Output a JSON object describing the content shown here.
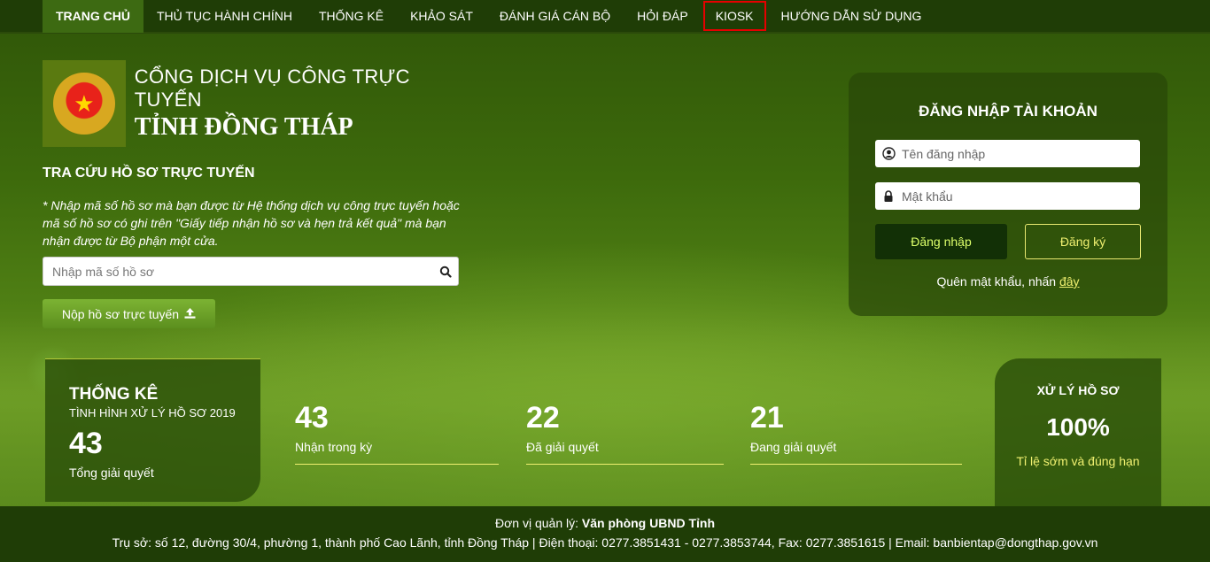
{
  "nav": {
    "items": [
      {
        "label": "TRANG CHỦ"
      },
      {
        "label": "THỦ TỤC HÀNH CHÍNH"
      },
      {
        "label": "THỐNG KÊ"
      },
      {
        "label": "KHẢO SÁT"
      },
      {
        "label": "ĐÁNH GIÁ CÁN BỘ"
      },
      {
        "label": "HỎI ĐÁP"
      },
      {
        "label": "KIOSK"
      },
      {
        "label": "HƯỚNG DẪN SỬ DỤNG"
      }
    ]
  },
  "header": {
    "line1": "CỔNG DỊCH VỤ CÔNG TRỰC TUYẾN",
    "line2": "TỈNH ĐỒNG THÁP"
  },
  "search": {
    "title": "TRA CỨU HỒ SƠ TRỰC TUYẾN",
    "note": "* Nhập mã số hồ sơ mà bạn được từ Hệ thống dịch vụ công trực tuyến hoặc mã số hồ sơ có ghi trên \"Giấy tiếp nhận hồ sơ và hẹn trả kết quả\" mà bạn nhận được từ Bộ phận một cửa.",
    "placeholder": "Nhập mã số hồ sơ",
    "submit_label": "Nộp hồ sơ trực tuyến"
  },
  "login": {
    "title": "ĐĂNG NHẬP TÀI KHOẢN",
    "username_placeholder": "Tên đăng nhập",
    "password_placeholder": "Mật khẩu",
    "login_label": "Đăng nhập",
    "register_label": "Đăng ký",
    "forgot_text": "Quên mật khẩu, nhấn",
    "forgot_link": "đây"
  },
  "stats": {
    "card_title": "THỐNG KÊ",
    "card_subtitle": "TÌNH HÌNH XỬ LÝ HỒ SƠ 2019",
    "total": "43",
    "total_label": "Tổng giải quyết",
    "items": [
      {
        "value": "43",
        "label": "Nhận trong kỳ"
      },
      {
        "value": "22",
        "label": "Đã giải quyết"
      },
      {
        "value": "21",
        "label": "Đang giải quyết"
      }
    ],
    "rate_title": "XỬ LÝ HỒ SƠ",
    "rate_value": "100%",
    "rate_label": "Tỉ lệ sớm và đúng hạn"
  },
  "footer": {
    "manager_label": "Đơn vị quản lý:",
    "manager_name": "Văn phòng UBND Tỉnh",
    "address": "Trụ sở: số 12, đường 30/4, phường 1, thành phố Cao Lãnh, tỉnh Đồng Tháp | Điện thoại: 0277.3851431 - 0277.3853744, Fax: 0277.3851615 | Email: banbientap@dongthap.gov.vn"
  },
  "colors": {
    "accent": "#f0f070",
    "nav_bg": "#1f3d06",
    "kiosk_highlight": "#e60000"
  },
  "icons": {
    "search": "search-icon",
    "upload": "upload-icon",
    "user": "user-icon",
    "lock": "lock-icon",
    "emblem": "national-emblem"
  }
}
